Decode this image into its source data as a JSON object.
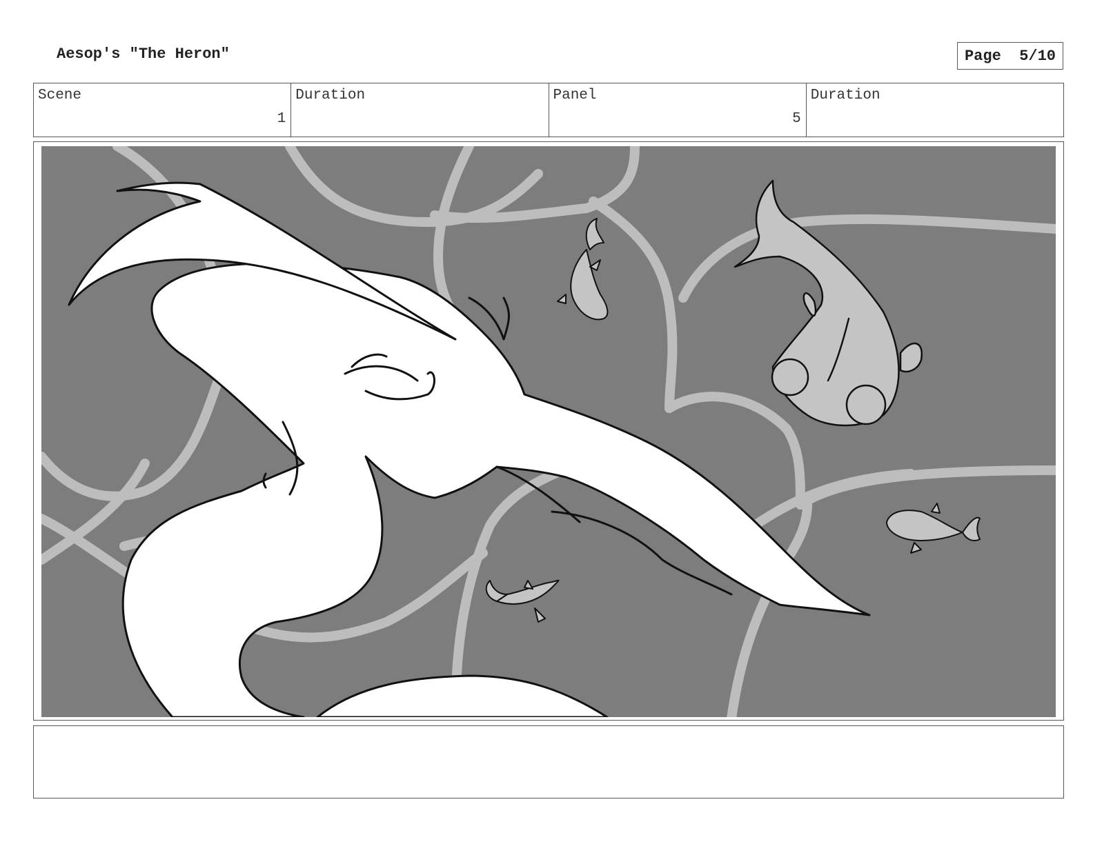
{
  "header": {
    "title": "Aesop's \"The Heron\"",
    "page_label": "Page  5/10"
  },
  "info": {
    "scene_label": "Scene",
    "scene_value": "1",
    "scene_duration_label": "Duration",
    "scene_duration_value": "",
    "panel_label": "Panel",
    "panel_value": "5",
    "panel_duration_label": "Duration",
    "panel_duration_value": ""
  },
  "panel": {
    "background_color": "#7d7d7d",
    "water_line_color": "#bdbdbd",
    "heron_color": "#ffffff",
    "fish_color": "#c4c4c4"
  },
  "notes": {
    "text": ""
  }
}
